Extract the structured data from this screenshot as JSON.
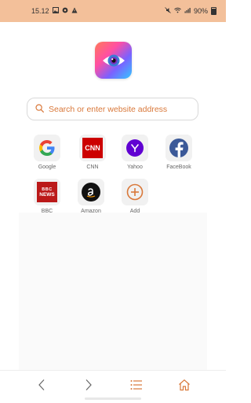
{
  "status_bar": {
    "time": "15.12",
    "battery": "90%",
    "left_icons": [
      "image-icon",
      "settings-icon",
      "warning-icon"
    ],
    "right_icons": [
      "mute-icon",
      "wifi-icon",
      "signal-icon",
      "battery-icon"
    ]
  },
  "search": {
    "placeholder": "Search or enter website address"
  },
  "shortcuts": [
    {
      "label": "Google",
      "icon": "google-icon"
    },
    {
      "label": "CNN",
      "icon": "cnn-icon"
    },
    {
      "label": "Yahoo",
      "icon": "yahoo-icon"
    },
    {
      "label": "FaceBook",
      "icon": "facebook-icon"
    },
    {
      "label": "BBC",
      "icon": "bbc-icon"
    },
    {
      "label": "Amazon",
      "icon": "amazon-icon"
    },
    {
      "label": "Add",
      "icon": "add-icon"
    }
  ],
  "bbc_icon_text": [
    "BBC",
    "NEWS"
  ],
  "cnn_icon_text": "CNN",
  "bottom_nav": [
    "back-icon",
    "forward-icon",
    "menu-icon",
    "home-icon"
  ],
  "colors": {
    "status_bar": "#f3c09a",
    "accent": "#d9783a",
    "google_blue": "#4285f4",
    "cnn_red": "#cc0000",
    "yahoo_purple": "#6001d2",
    "facebook_blue": "#3b5998",
    "bbc_red": "#bb1919"
  }
}
